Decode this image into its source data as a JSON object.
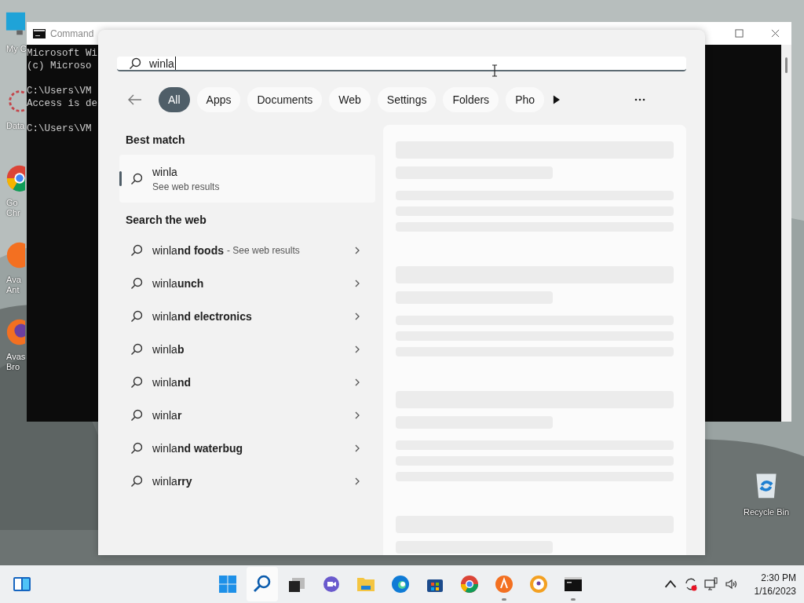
{
  "desktop": {
    "icons": [
      {
        "kind": "computer",
        "lines": [
          "My C"
        ]
      },
      {
        "kind": "dataviz",
        "lines": [
          "Data"
        ]
      },
      {
        "kind": "chrome",
        "lines": [
          "Go",
          "Chr"
        ]
      },
      {
        "kind": "avast",
        "lines": [
          "Ava",
          "Ant"
        ]
      },
      {
        "kind": "avast-browser",
        "lines": [
          "Avas",
          "Bro"
        ]
      }
    ],
    "recycle_bin": {
      "label": "Recycle Bin"
    }
  },
  "console_window": {
    "title": "Command",
    "blocks": [
      [
        "Microsoft Wi",
        "(c) Microso"
      ],
      [
        "C:\\Users\\VM",
        "Access is de"
      ],
      [
        "C:\\Users\\VM"
      ]
    ]
  },
  "search": {
    "query": "winla",
    "filters": [
      {
        "label": "All",
        "selected": true
      },
      {
        "label": "Apps",
        "selected": false
      },
      {
        "label": "Documents",
        "selected": false
      },
      {
        "label": "Web",
        "selected": false
      },
      {
        "label": "Settings",
        "selected": false
      },
      {
        "label": "Folders",
        "selected": false
      },
      {
        "label": "Pho",
        "selected": false
      }
    ],
    "best_match_heading": "Best match",
    "best_match": {
      "title": "winla",
      "subtitle": "See web results",
      "selected": true
    },
    "web_heading": "Search the web",
    "suggestions": [
      {
        "text": "winla**nd foods**",
        "hint": "- See web results"
      },
      {
        "text": "winla**unch**"
      },
      {
        "text": "winla**nd electronics**"
      },
      {
        "text": "winla**b**"
      },
      {
        "text": "winla**nd**"
      },
      {
        "text": "winla**r**"
      },
      {
        "text": "winla**nd waterbug**"
      },
      {
        "text": "winla**rry**"
      }
    ]
  },
  "taskbar": {
    "apps": [
      {
        "kind": "start",
        "selected": false,
        "running": false
      },
      {
        "kind": "search",
        "selected": true,
        "running": false
      },
      {
        "kind": "task-view",
        "selected": false,
        "running": false
      },
      {
        "kind": "chat",
        "selected": false,
        "running": false
      },
      {
        "kind": "explorer",
        "selected": false,
        "running": false
      },
      {
        "kind": "edge",
        "selected": false,
        "running": false
      },
      {
        "kind": "store",
        "selected": false,
        "running": false
      },
      {
        "kind": "chrome",
        "selected": false,
        "running": false
      },
      {
        "kind": "avast",
        "selected": false,
        "running": true
      },
      {
        "kind": "avast-browser",
        "selected": false,
        "running": false
      },
      {
        "kind": "terminal",
        "selected": false,
        "running": true
      }
    ],
    "clock": {
      "time": "2:30 PM",
      "date": "1/16/2023"
    }
  }
}
